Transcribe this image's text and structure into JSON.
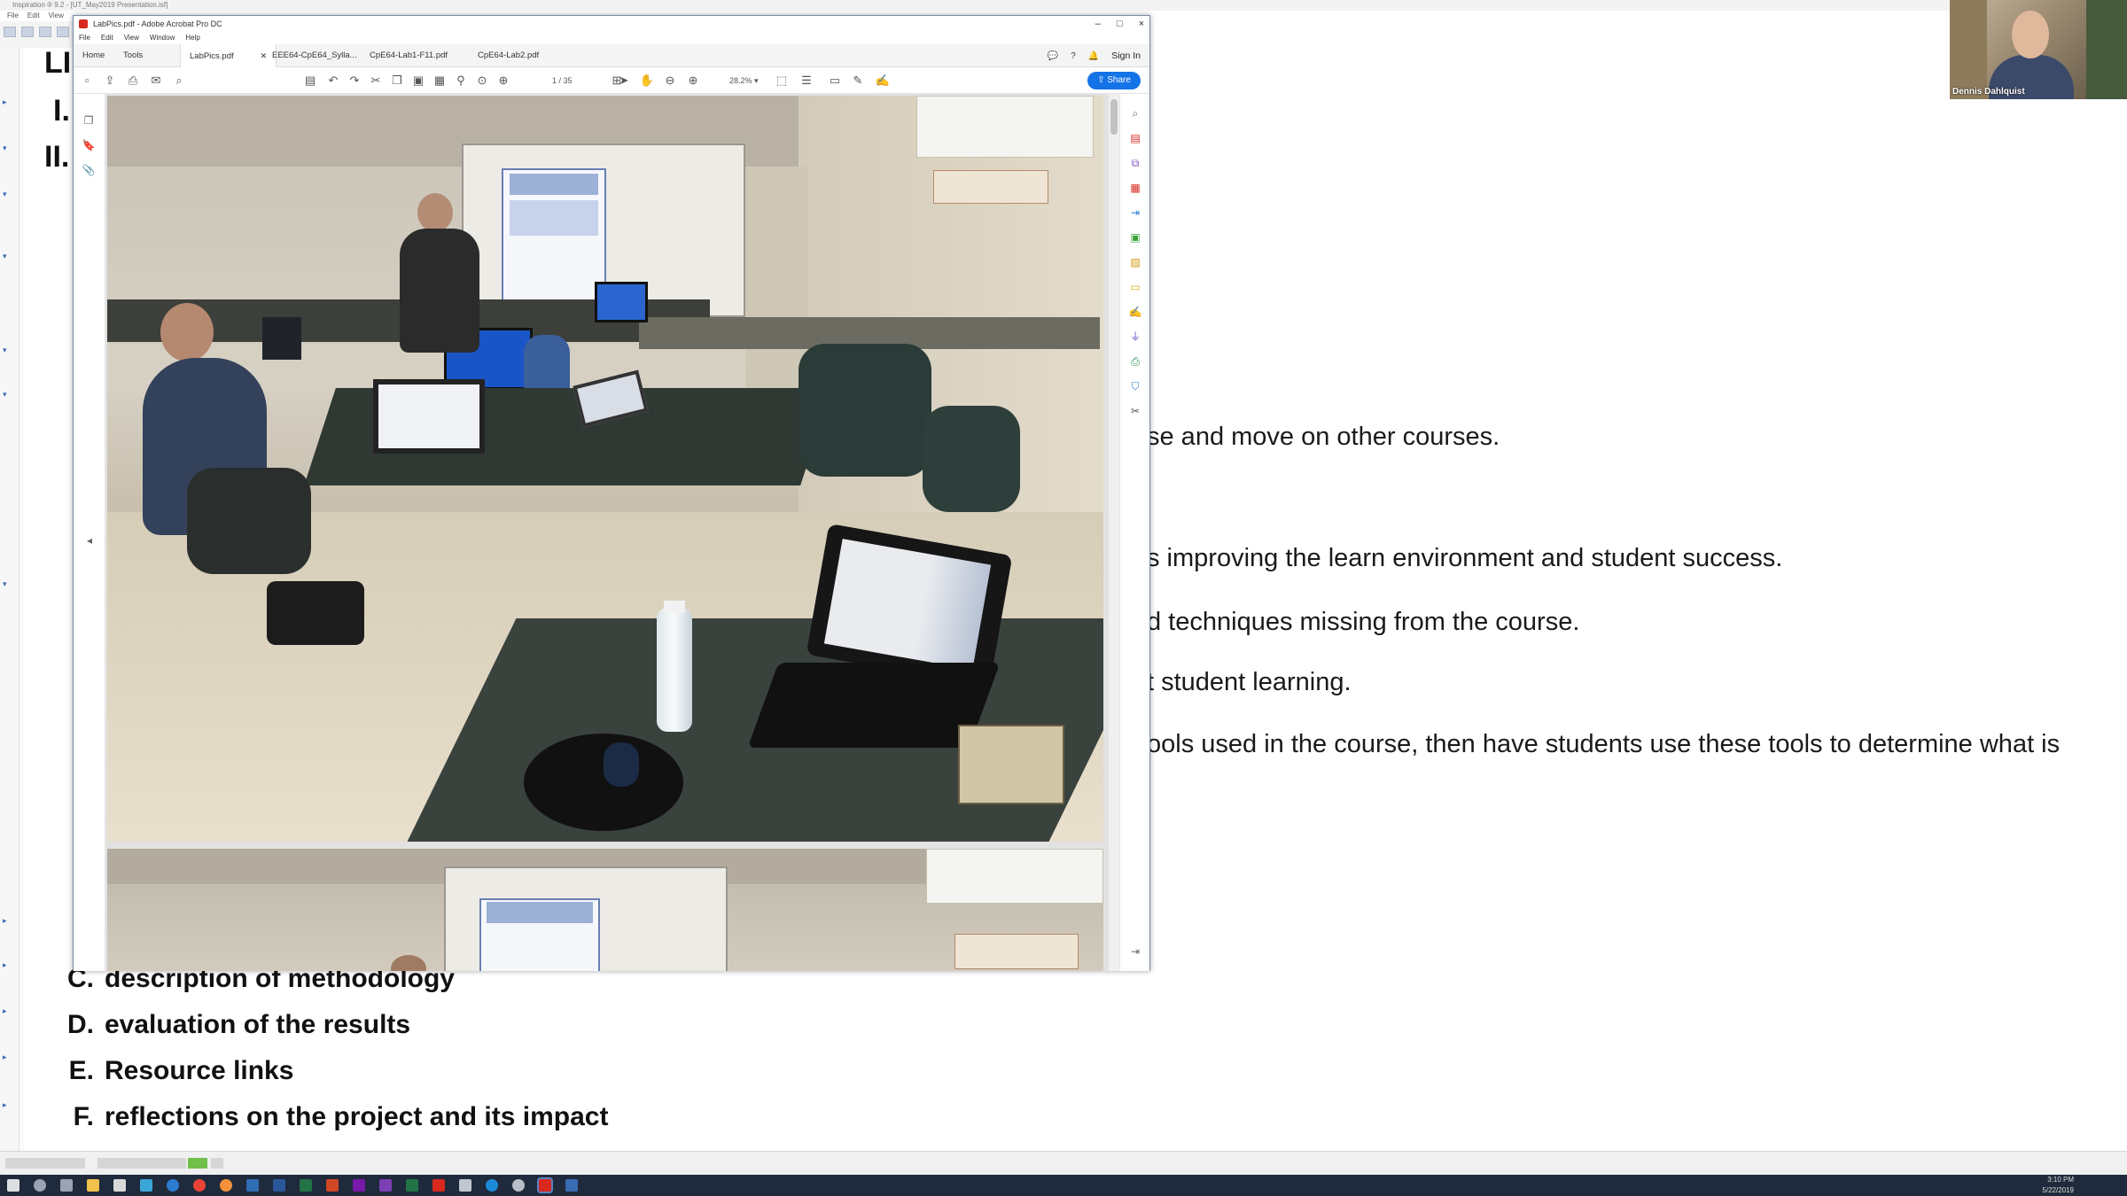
{
  "background_app": {
    "title": "Inspiration ® 9.2 - [UT_May2019 Presentation.isf]",
    "menu": [
      "File",
      "Edit",
      "View"
    ],
    "headings": [
      "LI",
      "I.",
      "II."
    ],
    "visible_text_lines": [
      "se and move on other courses.",
      "s improving the learn environment and student success.",
      "d techniques missing from the course.",
      "t student learning.",
      "ools used in the course, then have students use these tools to determine what is"
    ],
    "list_items": [
      {
        "letter": "C.",
        "text": "description of methodology"
      },
      {
        "letter": "D.",
        "text": "evaluation of the results"
      },
      {
        "letter": "E.",
        "text": "Resource links"
      },
      {
        "letter": "F.",
        "text": "reflections on the project and its impact"
      }
    ]
  },
  "webcam": {
    "participant_name": "Dennis Dahlquist"
  },
  "acrobat": {
    "window_title": "LabPics.pdf - Adobe Acrobat Pro DC",
    "window_controls": [
      "–",
      "□",
      "×"
    ],
    "menu": [
      "File",
      "Edit",
      "View",
      "Window",
      "Help"
    ],
    "nav": {
      "home": "Home",
      "tools": "Tools"
    },
    "tabs": [
      {
        "label": "LabPics.pdf",
        "active": true
      },
      {
        "label": "EEE64-CpE64_Sylla...",
        "active": false
      },
      {
        "label": "CpE64-Lab1-F11.pdf",
        "active": false
      },
      {
        "label": "CpE64-Lab2.pdf",
        "active": false
      }
    ],
    "sign_in": "Sign In",
    "page_current": "1",
    "page_total": "/ 35",
    "zoom": "28.2%",
    "share": "Share"
  },
  "taskbar": {
    "time": "3:10 PM",
    "date": "5/22/2019"
  },
  "colors": {
    "acrobat_red": "#d8281f",
    "share_blue": "#1473e6",
    "taskbar": "#1f2a3c"
  }
}
